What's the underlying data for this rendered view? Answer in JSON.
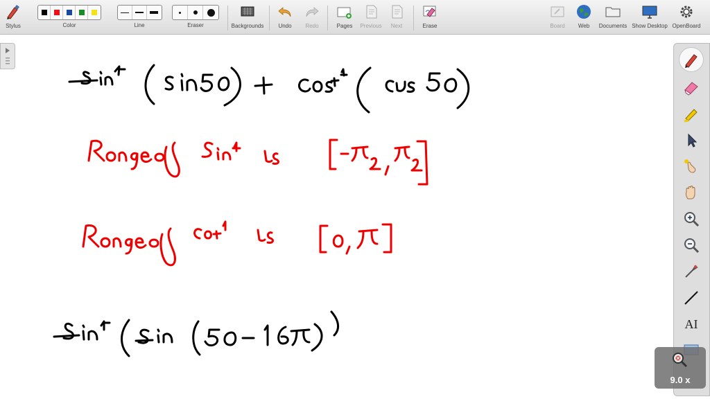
{
  "toolbar": {
    "stylus": "Stylus",
    "color": "Color",
    "line": "Line",
    "eraser": "Eraser",
    "backgrounds": "Backgrounds",
    "undo": "Undo",
    "redo": "Redo",
    "pages": "Pages",
    "previous": "Previous",
    "next": "Next",
    "erase": "Erase",
    "board": "Board",
    "web": "Web",
    "documents": "Documents",
    "show_desktop": "Show Desktop",
    "openboard": "OpenBoard"
  },
  "colors": {
    "swatches": [
      "#000000",
      "#e8141a",
      "#1a4a9c",
      "#1b8a2a",
      "#f3e21c"
    ],
    "ink_black": "#000000",
    "ink_red": "#ee0000"
  },
  "dock": {
    "text_tool_glyph": "AI",
    "icons": [
      "pen-icon",
      "eraser-icon",
      "marker-icon",
      "pointer-icon",
      "laser-pointer-icon",
      "hand-icon",
      "zoom-in-icon",
      "zoom-out-icon",
      "capture-icon",
      "line-icon",
      "text-icon",
      "capture-screen-icon"
    ]
  },
  "zoom": {
    "label": "9.0 x"
  }
}
